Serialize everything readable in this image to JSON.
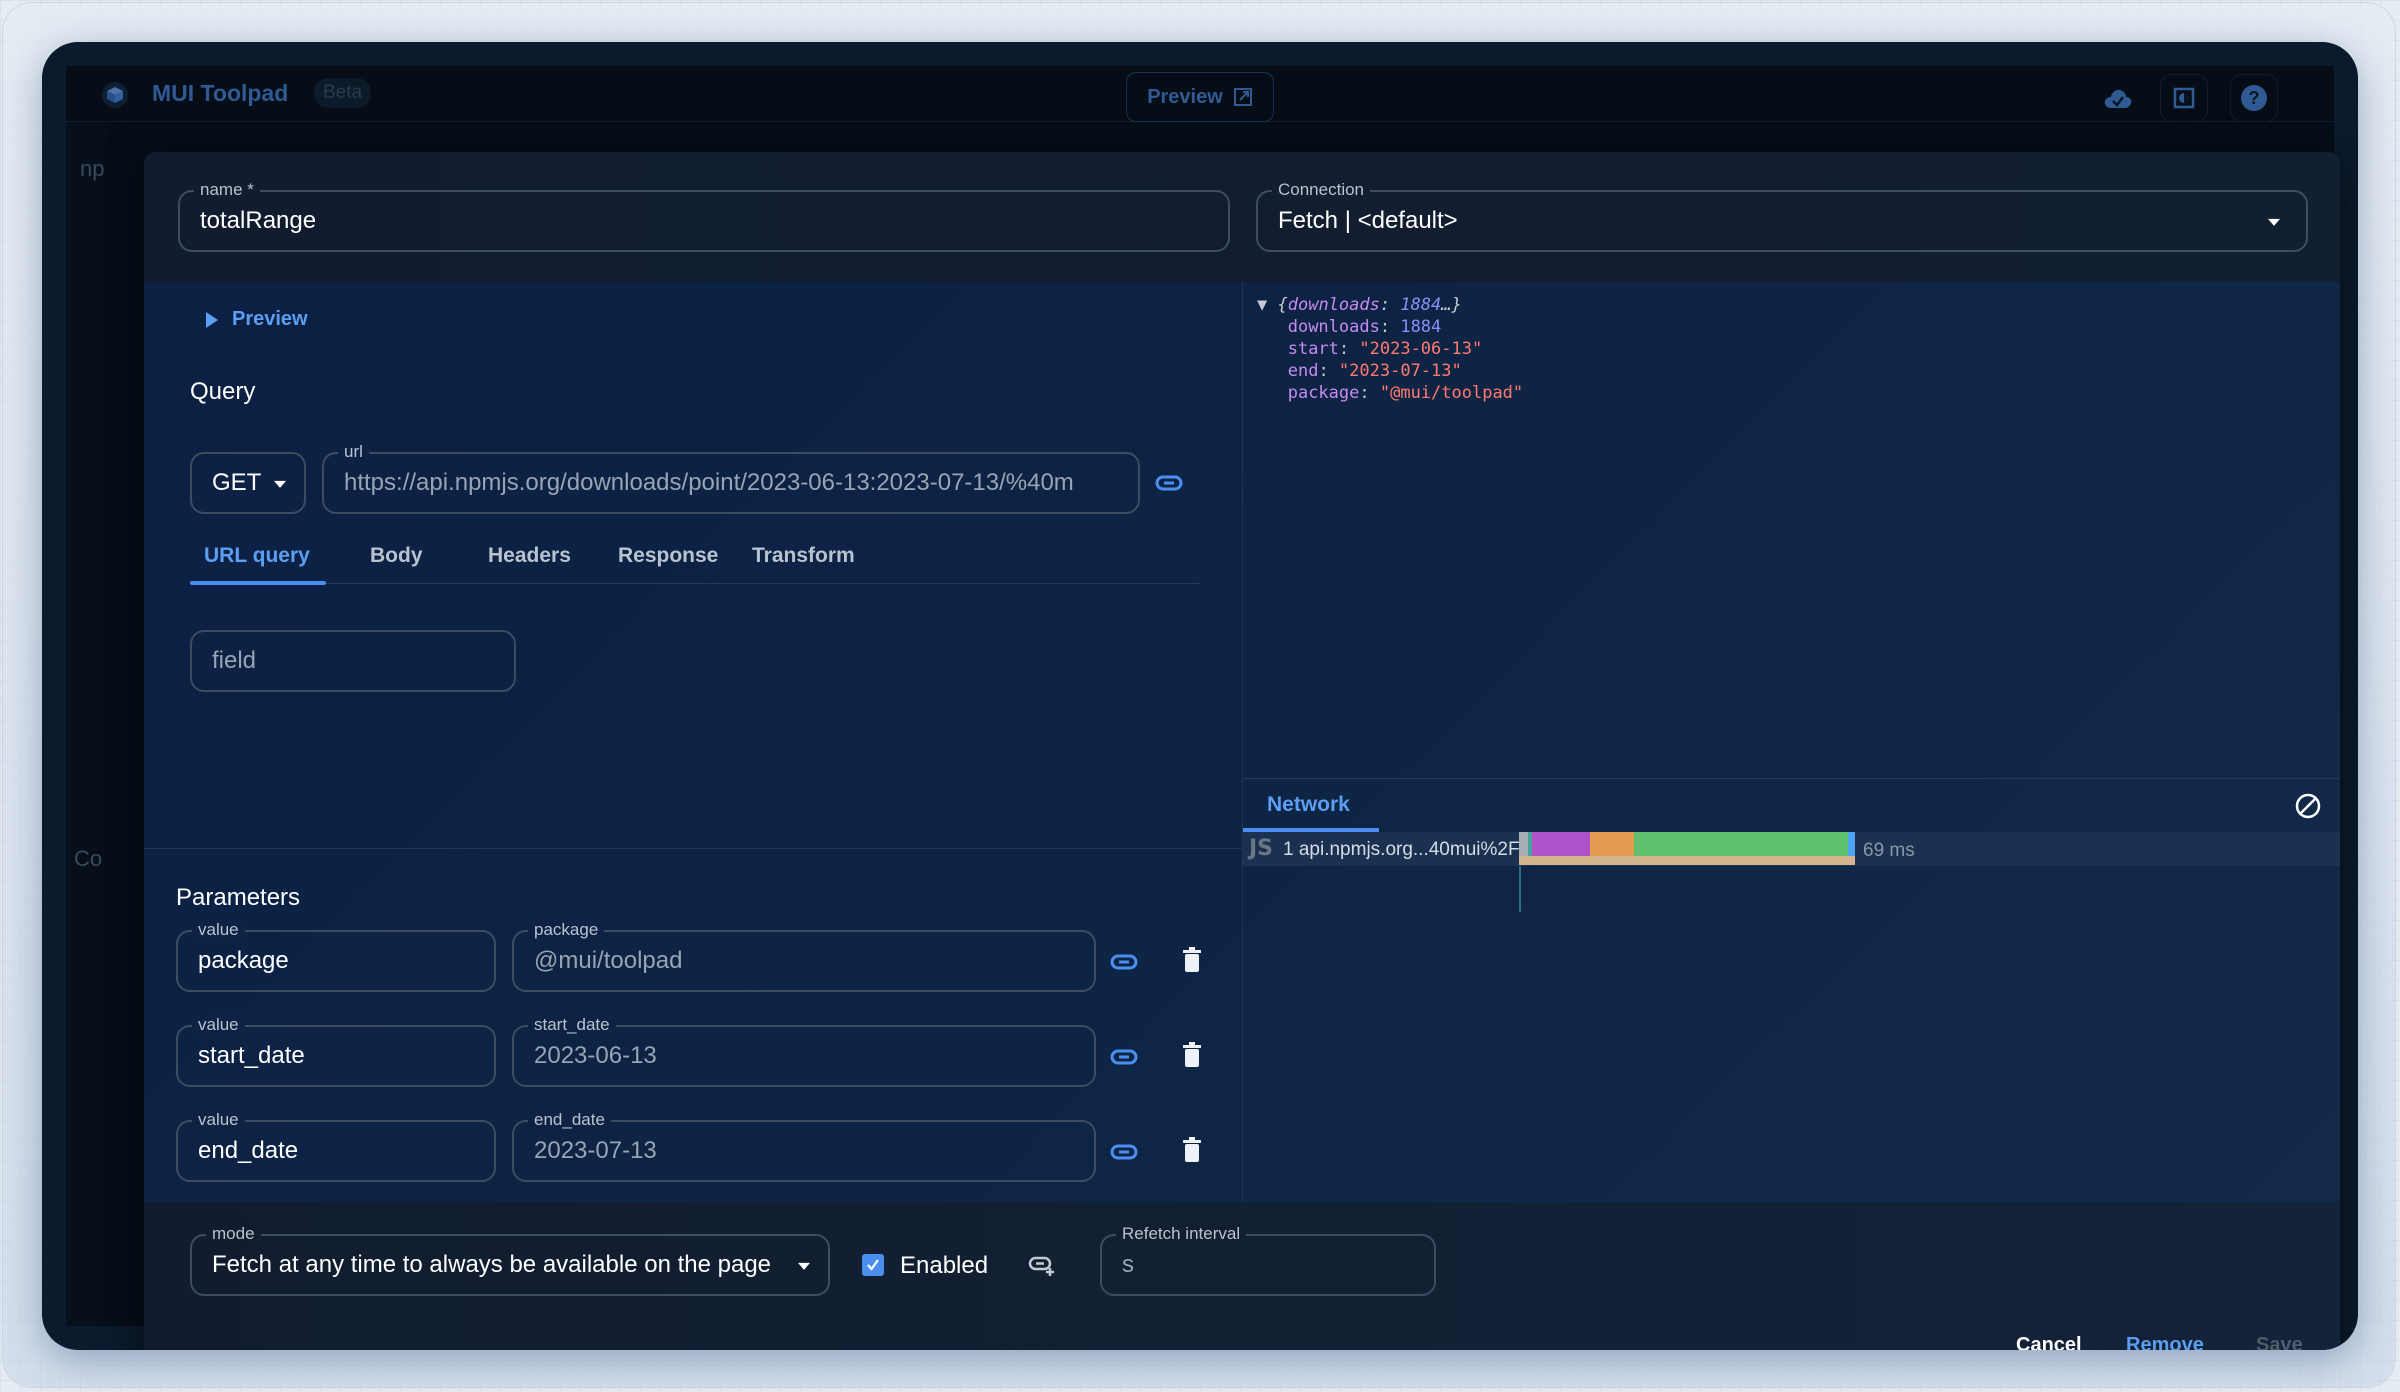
{
  "app": {
    "title": "MUI Toolpad",
    "badge": "Beta",
    "preview_button": "Preview",
    "side_text_1": "np",
    "side_text_2": "Co"
  },
  "dialog": {
    "name_field": {
      "label": "name *",
      "value": "totalRange"
    },
    "connection_field": {
      "label": "Connection",
      "value": "Fetch | <default>"
    },
    "preview_toggle": "Preview",
    "query_title": "Query",
    "method": "GET",
    "url_field": {
      "label": "url",
      "value": "https://api.npmjs.org/downloads/point/2023-06-13:2023-07-13/%40m"
    },
    "tabs": [
      {
        "label": "URL query",
        "active": true
      },
      {
        "label": "Body",
        "active": false
      },
      {
        "label": "Headers",
        "active": false
      },
      {
        "label": "Response",
        "active": false
      },
      {
        "label": "Transform",
        "active": false
      }
    ],
    "url_query_field": {
      "placeholder": "field"
    },
    "parameters_title": "Parameters",
    "parameters": [
      {
        "name_label": "value",
        "name": "package",
        "value_label": "package",
        "value": "@mui/toolpad"
      },
      {
        "name_label": "value",
        "name": "start_date",
        "value_label": "start_date",
        "value": "2023-06-13"
      },
      {
        "name_label": "value",
        "name": "end_date",
        "value_label": "end_date",
        "value": "2023-07-13"
      }
    ],
    "inspector": {
      "summary_key": "downloads",
      "summary_value": "1884",
      "summary_ellipsis": "…",
      "entries": [
        {
          "key": "downloads",
          "value": "1884",
          "type": "number"
        },
        {
          "key": "start",
          "value": "\"2023-06-13\"",
          "type": "string"
        },
        {
          "key": "end",
          "value": "\"2023-07-13\"",
          "type": "string"
        },
        {
          "key": "package",
          "value": "\"@mui/toolpad\"",
          "type": "string"
        }
      ]
    },
    "network": {
      "tab_label": "Network",
      "requests": [
        {
          "type": "JS",
          "name": "1 api.npmjs.org...40mui%2F",
          "duration": "69 ms"
        }
      ],
      "timing_colors": {
        "blocked": "#a7adb5",
        "connect": "#45a49b",
        "ssl": "#b052c9",
        "send": "#e59b50",
        "wait": "#5fc06f",
        "receive": "#4ea3f1",
        "total": "#d4b48f"
      }
    },
    "mode_field": {
      "label": "mode",
      "value": "Fetch at any time to always be available on the page"
    },
    "enabled_checkbox": {
      "label": "Enabled",
      "checked": true
    },
    "refetch_field": {
      "label": "Refetch interval",
      "value": "s"
    },
    "actions": {
      "cancel": "Cancel",
      "remove": "Remove",
      "save": "Save"
    }
  },
  "colors": {
    "accent": "#5c9ef2",
    "dialog_bg": "#0e2444",
    "text_primary": "#ffffff"
  }
}
